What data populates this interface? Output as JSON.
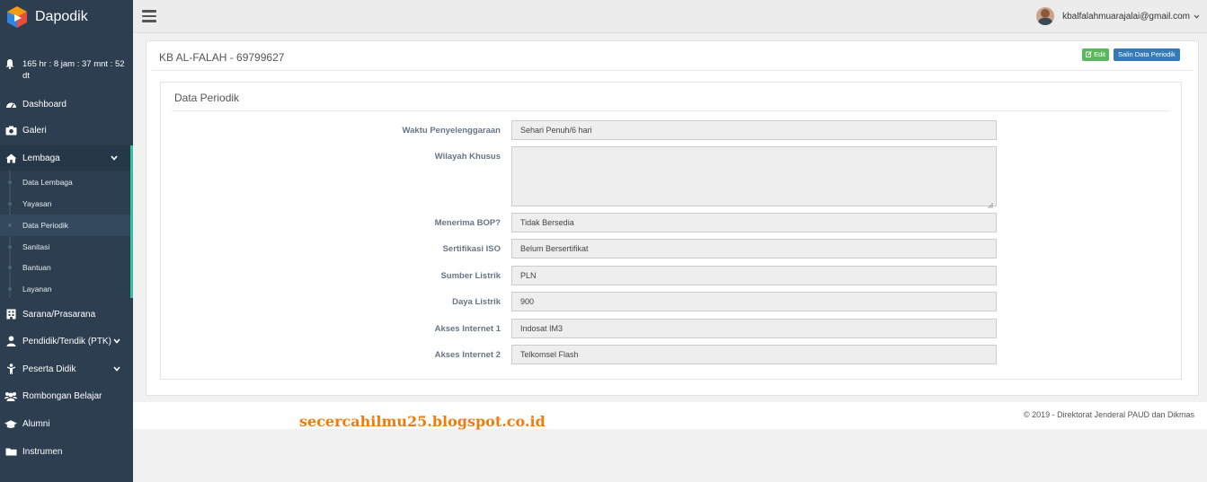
{
  "app": {
    "name": "Dapodik"
  },
  "timer": {
    "text": "165 hr : 8 jam : 37 mnt : 52 dt"
  },
  "sidebar": {
    "items": [
      {
        "label": "Dashboard",
        "icon": "dashboard-icon"
      },
      {
        "label": "Galeri",
        "icon": "camera-icon"
      },
      {
        "label": "Lembaga",
        "icon": "home-icon"
      },
      {
        "label": "Sarana/Prasarana",
        "icon": "building-icon"
      },
      {
        "label": "Pendidik/Tendik (PTK)",
        "icon": "user-icon"
      },
      {
        "label": "Peserta Didik",
        "icon": "child-icon"
      },
      {
        "label": "Rombongan Belajar",
        "icon": "users-icon"
      },
      {
        "label": "Alumni",
        "icon": "graduation-cap-icon"
      },
      {
        "label": "Instrumen",
        "icon": "folder-icon"
      }
    ],
    "lembaga_sub": [
      "Data Lembaga",
      "Yayasan",
      "Data Periodik",
      "Sanitasi",
      "Bantuan",
      "Layanan"
    ],
    "active_sub": "Data Periodik",
    "accent": "#34c29e"
  },
  "topbar": {
    "user_email": "kbalfalahmuarajalai@gmail.com"
  },
  "panel": {
    "title": "KB AL-FALAH - 69799627",
    "edit_label": "Edit",
    "salin_label": "Salin Data Periodik"
  },
  "form": {
    "section_title": "Data Periodik",
    "fields": [
      {
        "label": "Waktu Penyelenggaraan",
        "value": "Sehari Penuh/6 hari"
      },
      {
        "label": "Wilayah Khusus",
        "value": ""
      },
      {
        "label": "Menerima BOP?",
        "value": "Tidak Bersedia"
      },
      {
        "label": "Sertifikasi ISO",
        "value": "Belum Bersertifikat"
      },
      {
        "label": "Sumber Listrik",
        "value": "PLN"
      },
      {
        "label": "Daya Listrik",
        "value": "900"
      },
      {
        "label": "Akses Internet 1",
        "value": "Indosat IM3"
      },
      {
        "label": "Akses Internet 2",
        "value": "Telkomsel Flash"
      }
    ]
  },
  "footer": {
    "text": "©   2019 - Direktorat Jenderal PAUD dan Dikmas"
  },
  "watermark": "secercahilmu25.blogspot.co.id"
}
